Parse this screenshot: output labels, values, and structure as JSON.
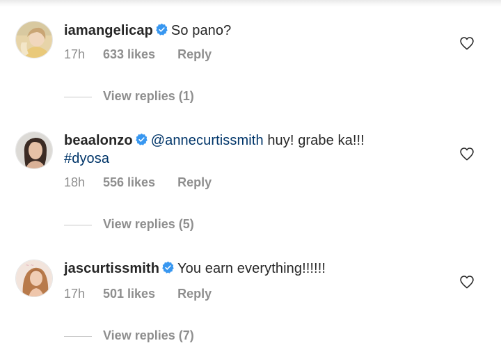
{
  "comments": [
    {
      "username": "iamangelicap",
      "verified": true,
      "mention": "",
      "text": "So pano?",
      "hashtag": "",
      "time": "17h",
      "likes": "633 likes",
      "reply_label": "Reply",
      "view_replies": "View replies (1)",
      "avatar_icon": "avatar-photo"
    },
    {
      "username": "beaalonzo",
      "verified": true,
      "mention": "@annecurtissmith",
      "text": " huy! grabe ka!!!",
      "hashtag": "#dyosa",
      "time": "18h",
      "likes": "556 likes",
      "reply_label": "Reply",
      "view_replies": "View replies (5)",
      "avatar_icon": "avatar-photo"
    },
    {
      "username": "jascurtissmith",
      "verified": true,
      "mention": "",
      "text": "You earn everything!!!!!!",
      "hashtag": "",
      "time": "17h",
      "likes": "501 likes",
      "reply_label": "Reply",
      "view_replies": "View replies (7)",
      "avatar_icon": "avatar-photo"
    }
  ],
  "icons": {
    "verified": "verified-badge-icon",
    "like": "heart-outline-icon"
  },
  "colors": {
    "text": "#262626",
    "meta": "#8e8e8e",
    "link": "#003569",
    "verified": "#3897f0"
  }
}
